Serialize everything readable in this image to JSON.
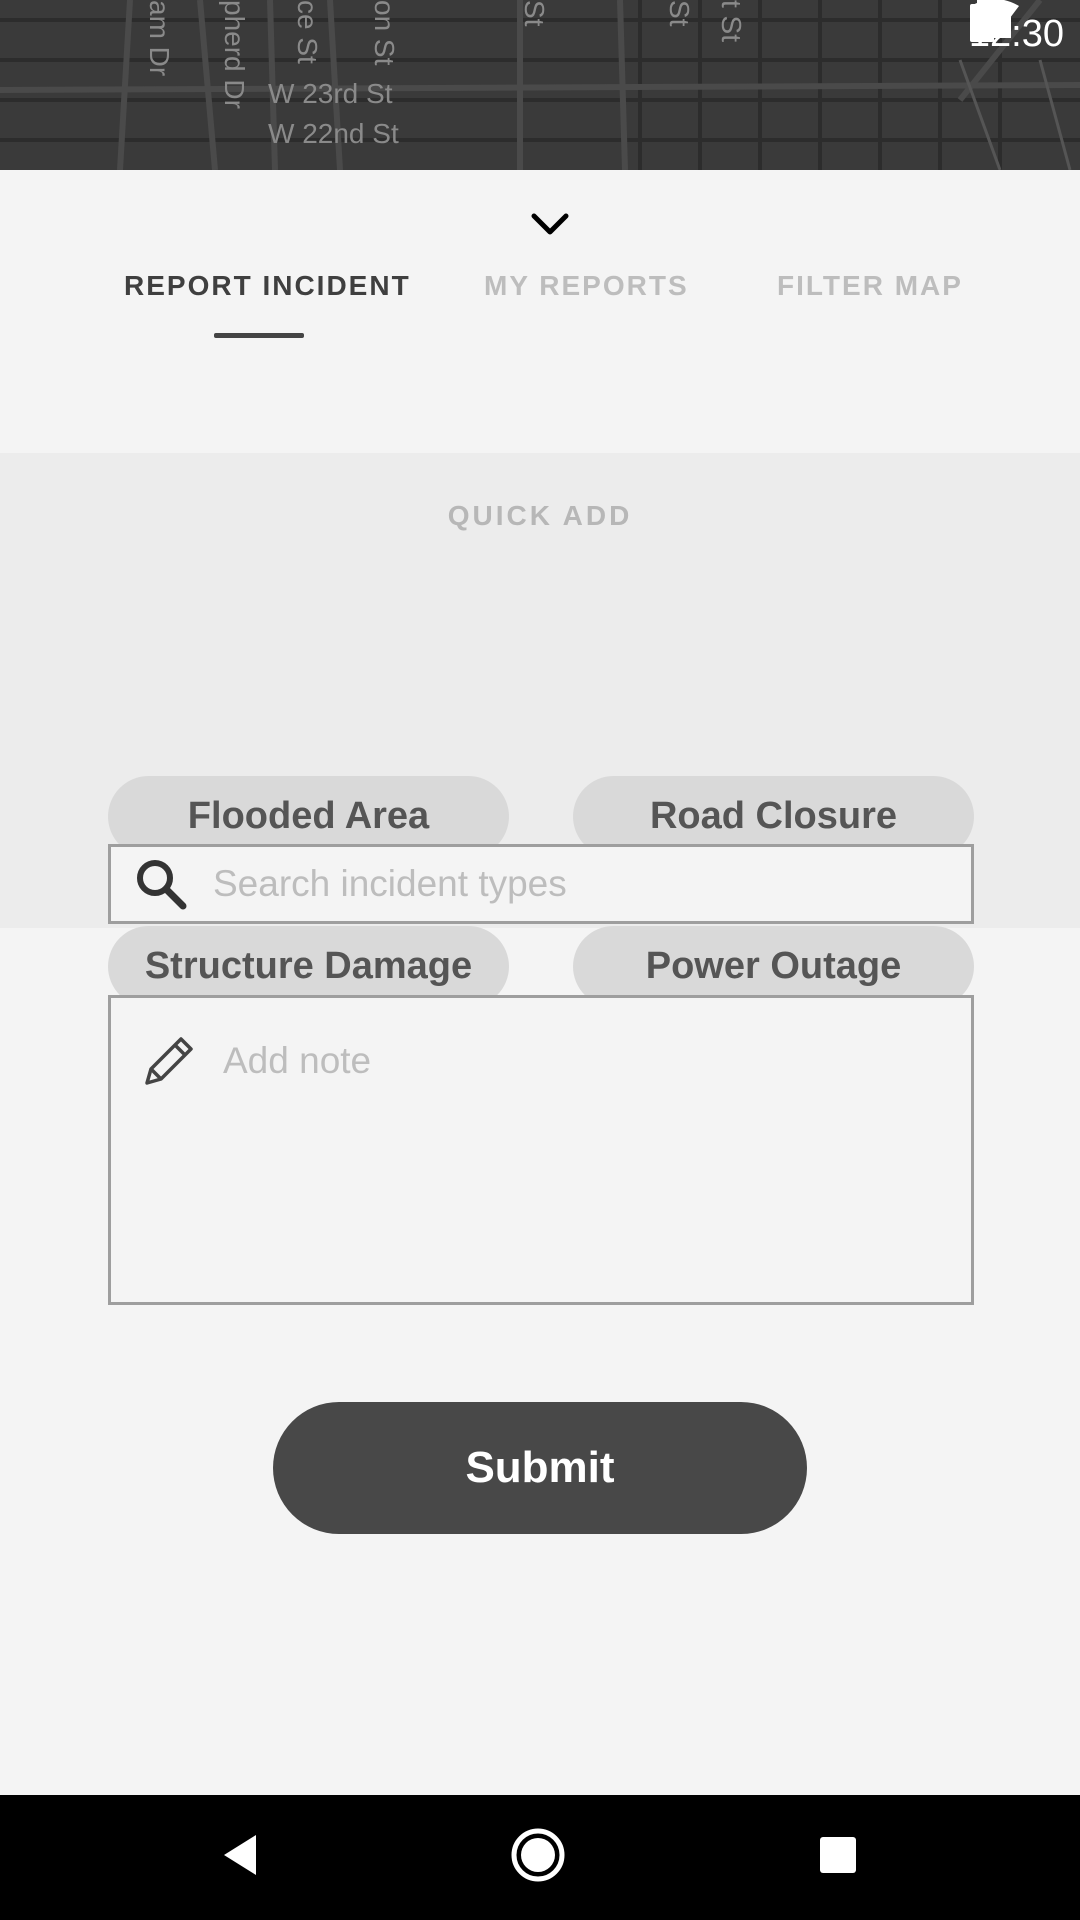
{
  "status_bar": {
    "time": "12:30"
  },
  "map": {
    "streets_horizontal": [
      "W 23rd St",
      "W 22nd St"
    ],
    "streets_vertical": [
      "am Dr",
      "pherd Dr",
      "ce St",
      "on St",
      "St",
      "St",
      "t St"
    ]
  },
  "sheet": {
    "tabs": [
      {
        "label": "REPORT INCIDENT",
        "active": true
      },
      {
        "label": "MY REPORTS",
        "active": false
      },
      {
        "label": "FILTER MAP",
        "active": false
      }
    ],
    "quick_add": {
      "title": "QUICK ADD",
      "chips": [
        "Flooded Area",
        "Road Closure",
        "Structure Damage",
        "Power Outage"
      ]
    },
    "search": {
      "placeholder": "Search incident types"
    },
    "note": {
      "placeholder": "Add note"
    },
    "submit_label": "Submit"
  },
  "colors": {
    "accent": "#484848",
    "chip_bg": "#d9d9d9",
    "quick_bg": "#ececec",
    "sheet_bg": "#f4f4f4"
  },
  "icons": [
    "wifi-icon",
    "signal-icon",
    "battery-icon",
    "chevron-down-icon",
    "search-icon",
    "pencil-icon",
    "back-icon",
    "home-icon",
    "recents-icon"
  ]
}
